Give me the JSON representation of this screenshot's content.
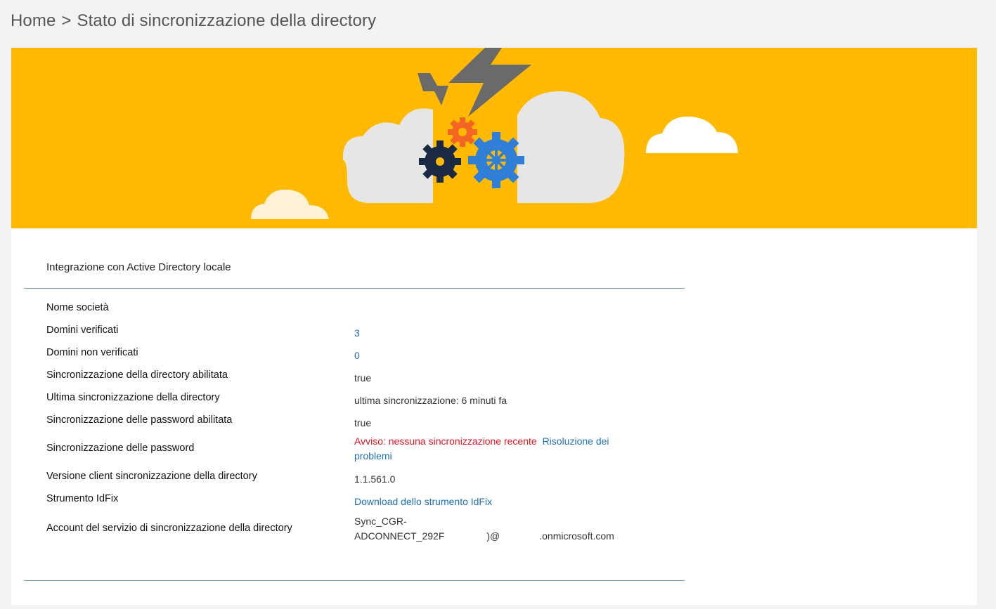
{
  "breadcrumb": {
    "home": "Home",
    "separator": ">",
    "current": "Stato di sincronizzazione della directory"
  },
  "section": {
    "title": "Integrazione con Active Directory locale"
  },
  "rows": {
    "company_name": {
      "label": "Nome società",
      "value": ""
    },
    "verified_domains": {
      "label": "Domini verificati",
      "value": "3"
    },
    "unverified_domains": {
      "label": "Domini non verificati",
      "value": "0"
    },
    "dirsync_enabled": {
      "label": "Sincronizzazione della directory abilitata",
      "value": "true"
    },
    "last_dirsync": {
      "label": "Ultima sincronizzazione della directory",
      "value": "ultima sincronizzazione: 6 minuti fa"
    },
    "password_sync_enabled": {
      "label": "Sincronizzazione delle password abilitata",
      "value": "true"
    },
    "password_sync": {
      "label": "Sincronizzazione delle password",
      "warning": "Avviso: nessuna sincronizzazione recente",
      "troubleshoot_line1": "Risoluzione dei",
      "troubleshoot_line2": "problemi"
    },
    "client_version": {
      "label": "Versione client sincronizzazione della directory",
      "value": "1.1.561.0"
    },
    "idfix": {
      "label": "Strumento IdFix",
      "link": "Download dello strumento IdFix"
    },
    "service_account": {
      "label": "Account del servizio di sincronizzazione della directory",
      "line1": "Sync_CGR-",
      "line2_part1": "ADCONNECT_292F",
      "line2_part2": ")@",
      "line2_part3": ".onmicrosoft.com"
    }
  },
  "colors": {
    "banner": "#ffb900",
    "link": "#1f6fb2",
    "warning": "#e81123",
    "rule": "#7ba1c0"
  },
  "icons": [
    "lightning-bolt-icon",
    "gear-icon",
    "cloud-icon"
  ]
}
